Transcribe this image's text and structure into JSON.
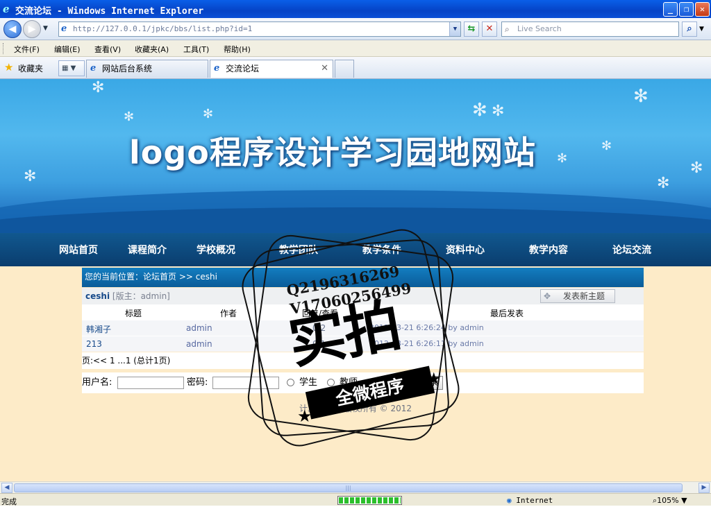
{
  "window": {
    "title": "交流论坛 - Windows Internet Explorer",
    "minimize": "_",
    "restore": "❐",
    "close": "✕"
  },
  "address_bar": {
    "url": "http://127.0.0.1/jpkc/bbs/list.php?id=1",
    "search_placeholder": "Live Search"
  },
  "menu": [
    "文件(F)",
    "编辑(E)",
    "查看(V)",
    "收藏夹(A)",
    "工具(T)",
    "帮助(H)"
  ],
  "favorites": {
    "label": "收藏夹",
    "tabs": [
      {
        "label": "网站后台系统"
      },
      {
        "label": "交流论坛"
      }
    ]
  },
  "site": {
    "logo": "logo程序设计学习园地网站",
    "nav": [
      "网站首页",
      "课程简介",
      "学校概况",
      "教学团队",
      "教学条件",
      "资料中心",
      "教学内容",
      "论坛交流"
    ],
    "breadcrumb": "您的当前位置：论坛首页 >> ceshi",
    "forum_name": "ceshi",
    "moderator": "[版主：admin]",
    "new_topic_button": "发表新主题",
    "table_headers": [
      "标题",
      "作者",
      "回复/查看",
      "最后发表"
    ],
    "rows": [
      {
        "title": "韩湘子",
        "author": "admin",
        "replies": "0/2",
        "last": "2012-03-21 6:26:24 by admin"
      },
      {
        "title": "213",
        "author": "admin",
        "replies": "0/1",
        "last": "2012-03-21 6:26:11 by admin"
      }
    ],
    "pagination": "页:<< 1 ...1 (总计1页)",
    "login": {
      "username_label": "用户名:",
      "password_label": "密码:",
      "roles": [
        "学生",
        "教师",
        "管理员"
      ],
      "selected_role": "管理员",
      "button": "登 录"
    },
    "footer": "计算机学院 版权所有 © 2012"
  },
  "watermark": {
    "line1": "Q2196316269",
    "line2": "V17060256499",
    "big": "实拍",
    "band": "全微程序"
  },
  "status": {
    "text": "完成",
    "progress": 1.0,
    "zone": "Internet",
    "zoom": "105%"
  }
}
